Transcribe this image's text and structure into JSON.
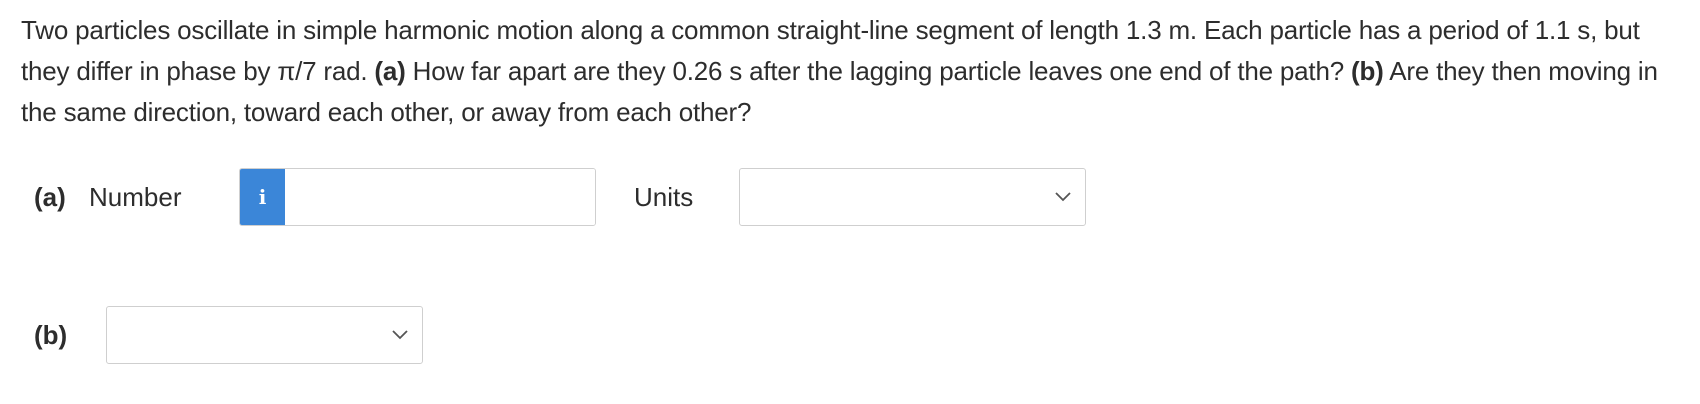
{
  "question": {
    "sentence_1": "Two particles oscillate in simple harmonic motion along a common straight-line segment of length 1.3 m. Each particle has a period of 1.1 s, but they differ in phase by π/7 rad. ",
    "part_a_tag": "(a)",
    "part_a_text": " How far apart are they 0.26 s after the lagging particle leaves one end of the path? ",
    "part_b_tag": "(b)",
    "part_b_text": " Are they then moving in the same direction, toward each other, or away from each other?"
  },
  "answer_a": {
    "label": "(a)",
    "number_label": "Number",
    "info_icon": "i",
    "number_value": "",
    "units_label": "Units",
    "units_selected": ""
  },
  "answer_b": {
    "label": "(b)",
    "selected": ""
  },
  "colors": {
    "info_button": "#3b86d8",
    "text": "#2d2d2d",
    "border": "#cfcfcf"
  }
}
